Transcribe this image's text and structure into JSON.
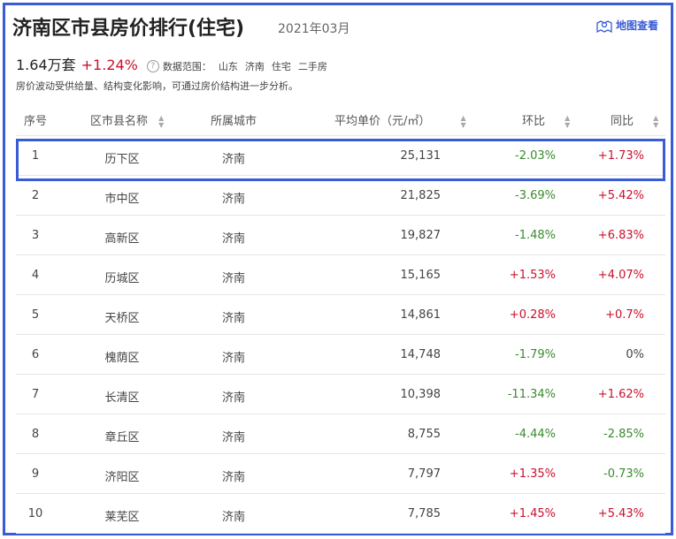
{
  "header": {
    "title": "济南区市县房价排行(住宅)",
    "date": "2021年03月",
    "map_link": "地图查看"
  },
  "summary": {
    "price": "1.64万套",
    "change": "+1.24%",
    "range_label": "数据范围：",
    "range_items": [
      "山东",
      "济南",
      "住宅",
      "二手房"
    ],
    "note": "房价波动受供给量、结构变化影响，可通过房价结构进一步分析。"
  },
  "table": {
    "columns": [
      "序号",
      "区市县名称",
      "所属城市",
      "平均单价（元/㎡）",
      "环比",
      "同比"
    ],
    "rows": [
      {
        "rank": "1",
        "district": "历下区",
        "city": "济南",
        "price": "25,131",
        "mom": "-2.03%",
        "yoy": "+1.73%"
      },
      {
        "rank": "2",
        "district": "市中区",
        "city": "济南",
        "price": "21,825",
        "mom": "-3.69%",
        "yoy": "+5.42%"
      },
      {
        "rank": "3",
        "district": "高新区",
        "city": "济南",
        "price": "19,827",
        "mom": "-1.48%",
        "yoy": "+6.83%"
      },
      {
        "rank": "4",
        "district": "历城区",
        "city": "济南",
        "price": "15,165",
        "mom": "+1.53%",
        "yoy": "+4.07%"
      },
      {
        "rank": "5",
        "district": "天桥区",
        "city": "济南",
        "price": "14,861",
        "mom": "+0.28%",
        "yoy": "+0.7%"
      },
      {
        "rank": "6",
        "district": "槐荫区",
        "city": "济南",
        "price": "14,748",
        "mom": "-1.79%",
        "yoy": "0%"
      },
      {
        "rank": "7",
        "district": "长清区",
        "city": "济南",
        "price": "10,398",
        "mom": "-11.34%",
        "yoy": "+1.62%"
      },
      {
        "rank": "8",
        "district": "章丘区",
        "city": "济南",
        "price": "8,755",
        "mom": "-4.44%",
        "yoy": "-2.85%"
      },
      {
        "rank": "9",
        "district": "济阳区",
        "city": "济南",
        "price": "7,797",
        "mom": "+1.35%",
        "yoy": "-0.73%"
      },
      {
        "rank": "10",
        "district": "莱芜区",
        "city": "济南",
        "price": "7,785",
        "mom": "+1.45%",
        "yoy": "+5.43%"
      }
    ]
  },
  "colors": {
    "frame": "#3a5bd6",
    "up": "#c8102e",
    "down": "#3a8a2e",
    "neutral": "#444444"
  },
  "icons": {
    "map": "map-pin-icon",
    "help": "question-circle-icon",
    "sort": "sort-arrows-icon"
  }
}
